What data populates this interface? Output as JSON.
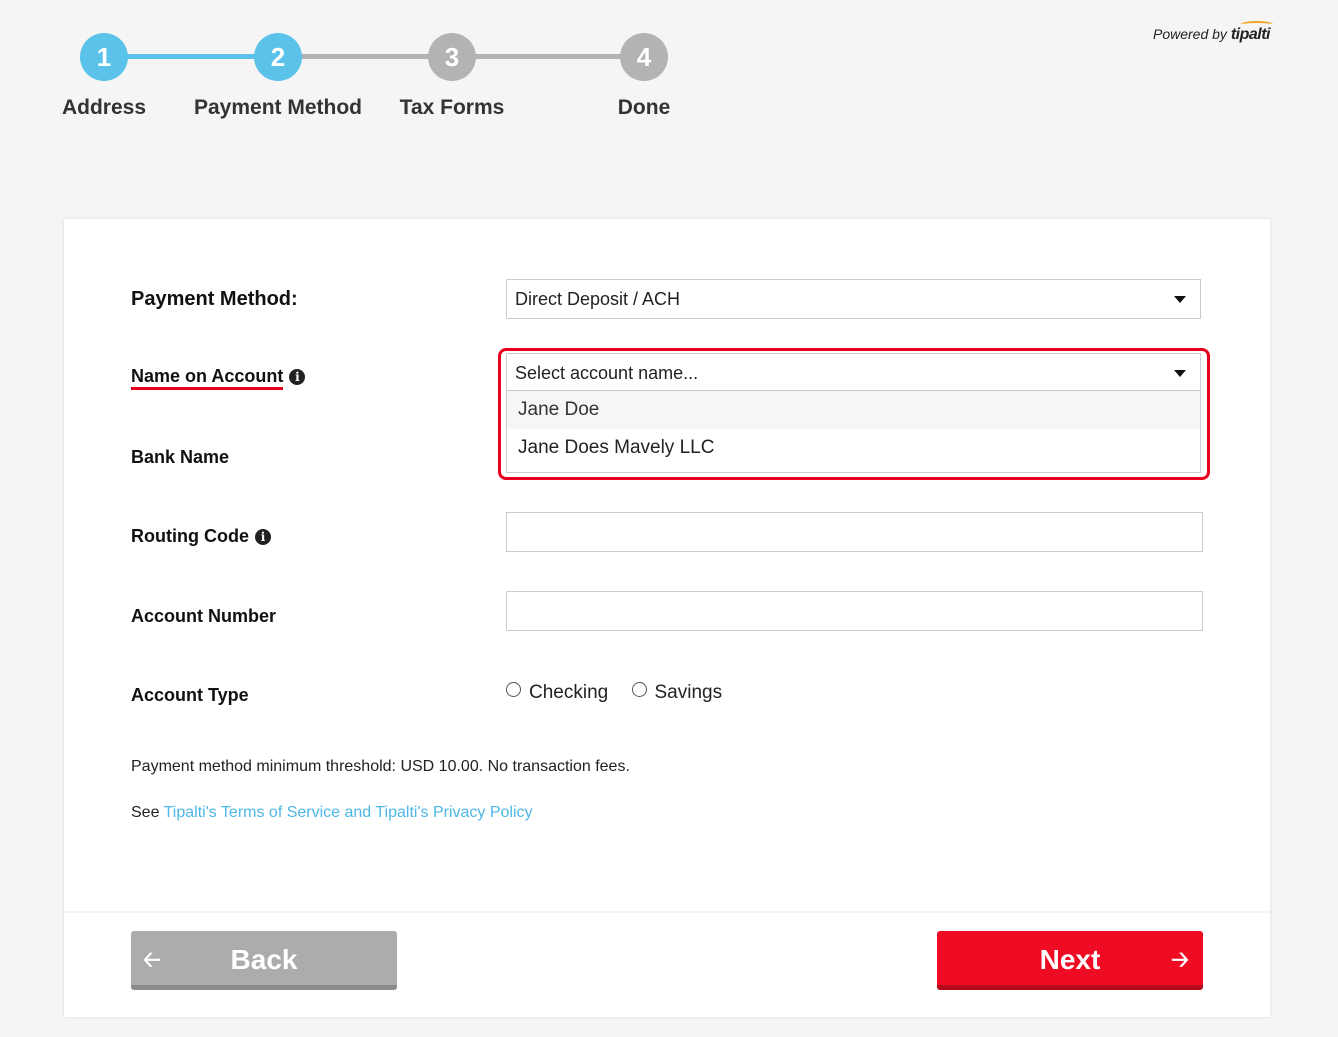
{
  "stepper": {
    "steps": [
      {
        "number": "1",
        "label": "Address",
        "state": "active"
      },
      {
        "number": "2",
        "label": "Payment Method",
        "state": "active"
      },
      {
        "number": "3",
        "label": "Tax Forms",
        "state": "inactive"
      },
      {
        "number": "4",
        "label": "Done",
        "state": "inactive"
      }
    ]
  },
  "branding": {
    "powered_by": "Powered by",
    "brand": "tipalti"
  },
  "form": {
    "payment_method": {
      "label": "Payment Method:",
      "value": "Direct Deposit / ACH"
    },
    "name_on_account": {
      "label": "Name on Account",
      "placeholder": "Select account name...",
      "options": [
        "Jane Doe",
        "Jane Does Mavely LLC"
      ]
    },
    "bank_name": {
      "label": "Bank Name"
    },
    "routing_code": {
      "label": "Routing Code"
    },
    "account_number": {
      "label": "Account Number"
    },
    "account_type": {
      "label": "Account Type",
      "options": [
        "Checking",
        "Savings"
      ]
    },
    "threshold_note": "Payment method minimum threshold: USD 10.00. No transaction fees.",
    "terms_prefix": "See",
    "terms_link": "Tipalti's Terms of Service and Tipalti's Privacy Policy"
  },
  "buttons": {
    "back": "Back",
    "next": "Next"
  },
  "colors": {
    "accent": "#5bc2ea",
    "inactive": "#b3b3b3",
    "primary": "#ee0b23",
    "highlight": "#e8001d",
    "link": "#4db7e6"
  },
  "icons": {
    "info": "info-icon",
    "back_arrow": "arrow-left-icon",
    "next_arrow": "arrow-right-icon",
    "caret": "caret-down-icon"
  }
}
